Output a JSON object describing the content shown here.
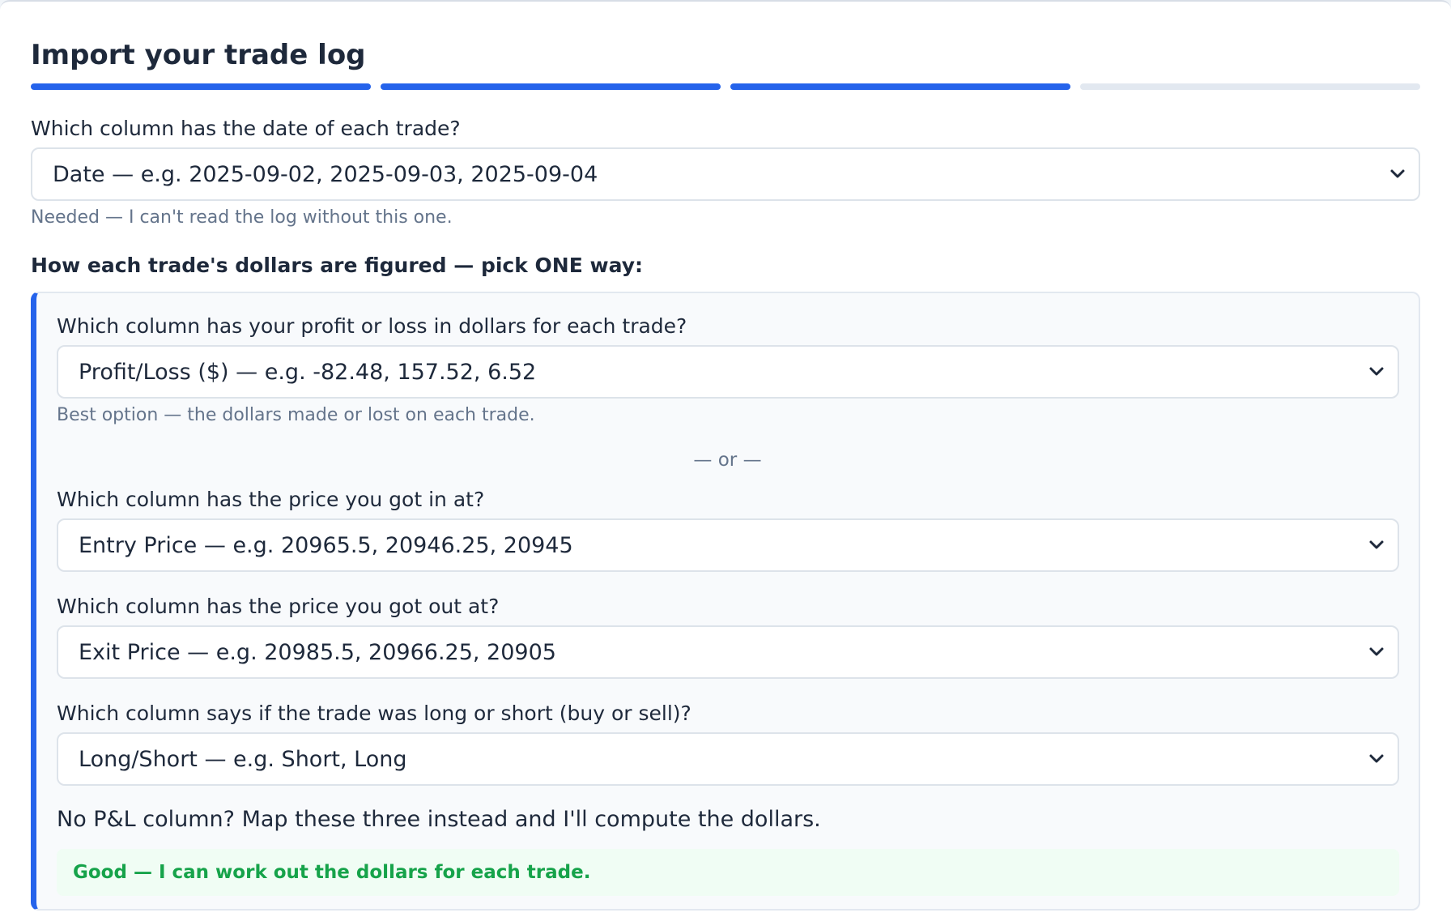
{
  "header": {
    "title": "Import your trade log",
    "steps": [
      {
        "state": "done"
      },
      {
        "state": "done"
      },
      {
        "state": "done"
      },
      {
        "state": "pending"
      }
    ]
  },
  "date_field": {
    "label": "Which column has the date of each trade?",
    "value": "Date — e.g. 2025-09-02, 2025-09-03, 2025-09-04",
    "hint": "Needed — I can't read the log without this one."
  },
  "dollars_section": {
    "heading": "How each trade's dollars are figured — pick ONE way:",
    "pnl_field": {
      "label": "Which column has your profit or loss in dollars for each trade?",
      "value": "Profit/Loss ($) — e.g. -82.48, 157.52, 6.52",
      "hint": "Best option — the dollars made or lost on each trade."
    },
    "or_divider": "— or —",
    "entry_field": {
      "label": "Which column has the price you got in at?",
      "value": "Entry Price — e.g. 20965.5, 20946.25, 20945"
    },
    "exit_field": {
      "label": "Which column has the price you got out at?",
      "value": "Exit Price — e.g. 20985.5, 20966.25, 20905"
    },
    "direction_field": {
      "label": "Which column says if the trade was long or short (buy or sell)?",
      "value": "Long/Short — e.g. Short, Long"
    },
    "note": "No P&L column? Map these three instead and I'll compute the dollars.",
    "status": "Good — I can work out the dollars for each trade."
  },
  "colors": {
    "accent": "#2563eb",
    "success": "#16a34a",
    "success_bg": "#f0fdf4",
    "muted_text": "#64748b"
  },
  "icons": {
    "select_arrow": "chevron-down-icon"
  }
}
